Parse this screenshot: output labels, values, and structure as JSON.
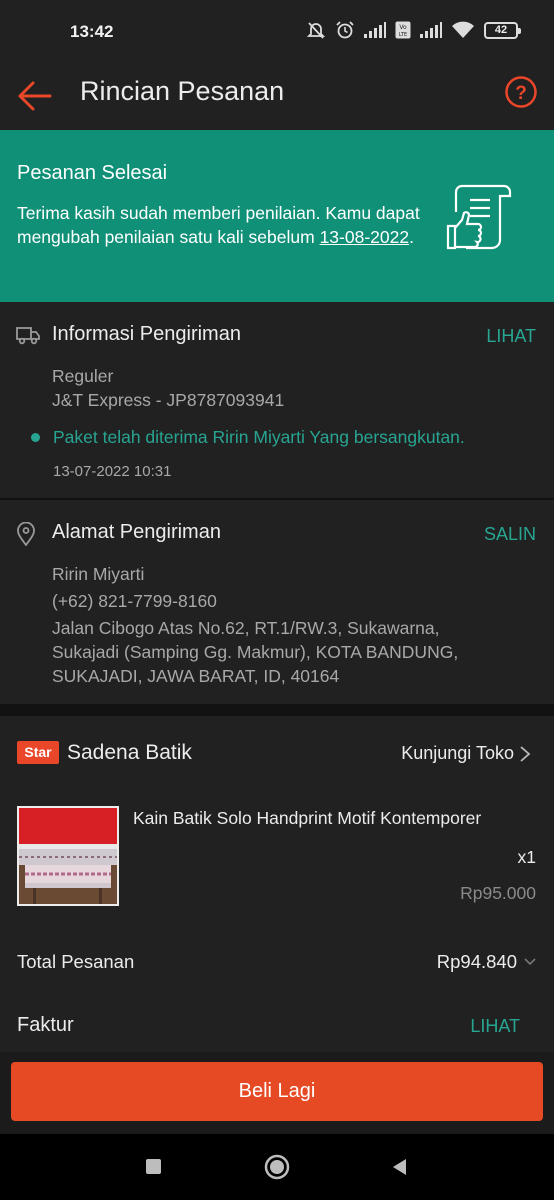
{
  "status_bar": {
    "time": "13:42",
    "battery": "42"
  },
  "header": {
    "title": "Rincian Pesanan"
  },
  "banner": {
    "title": "Pesanan Selesai",
    "text": "Terima kasih sudah memberi penilaian. Kamu dapat mengubah penilaian satu kali sebelum ",
    "date": "13-08-2022",
    "suffix": "."
  },
  "shipping_info": {
    "title": "Informasi Pengiriman",
    "action": "LIHAT",
    "service": "Reguler",
    "courier": "J&T Express - JP8787093941",
    "status": "Paket telah diterima Ririn Miyarti Yang bersangkutan.",
    "timestamp": "13-07-2022 10:31"
  },
  "address": {
    "title": "Alamat Pengiriman",
    "action": "SALIN",
    "name": "Ririn Miyarti",
    "phone": "(+62) 821-7799-8160",
    "line1": "Jalan Cibogo Atas No.62, RT.1/RW.3, Sukawarna,",
    "line2": "Sukajadi (Samping Gg. Makmur), KOTA BANDUNG,",
    "line3": "SUKAJADI, JAWA BARAT, ID, 40164"
  },
  "shop": {
    "badge": "Star",
    "name": "Sadena Batik",
    "visit": "Kunjungi Toko"
  },
  "product": {
    "name": "Kain Batik Solo Handprint Motif Kontemporer",
    "qty": "x1",
    "price": "Rp95.000"
  },
  "total": {
    "label": "Total Pesanan",
    "value": "Rp94.840"
  },
  "invoice": {
    "label": "Faktur",
    "action": "LIHAT"
  },
  "footer": {
    "button": "Beli Lagi"
  },
  "colors": {
    "accent": "#e64a25",
    "teal": "#109077",
    "link": "#28a592"
  }
}
